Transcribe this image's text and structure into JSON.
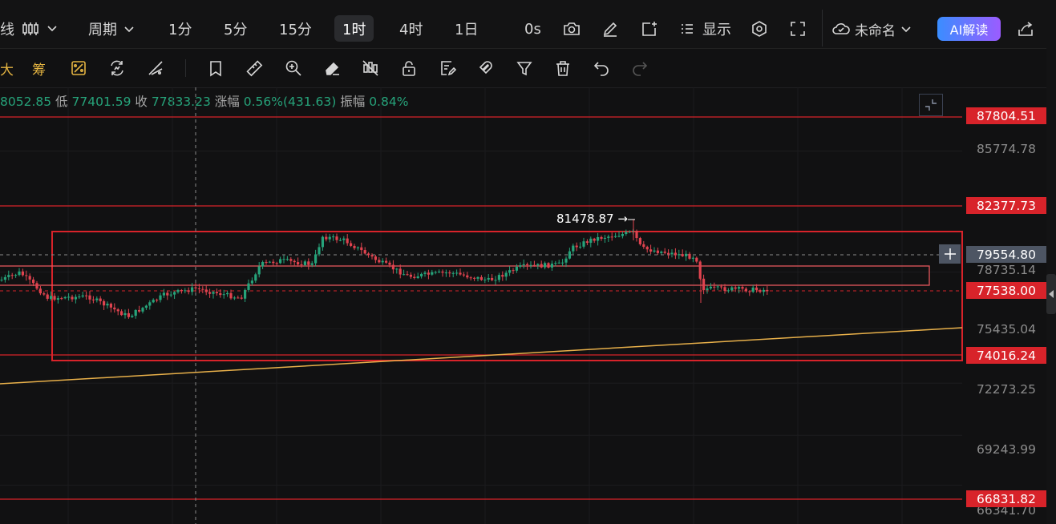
{
  "topbar": {
    "chart_type_partial": "线",
    "period_label": "周期",
    "timeframes": [
      "1分",
      "5分",
      "15分",
      "1时",
      "4时",
      "1日"
    ],
    "active_timeframe": "1时",
    "countdown": "0s",
    "display_label": "显示",
    "layout_name": "未命名",
    "ai_button": "AI解读"
  },
  "toolbar2": {
    "text_items": [
      "大",
      "筹"
    ]
  },
  "info_row": {
    "high_partial": "8052.85",
    "low_label": "低",
    "low_value": "77401.59",
    "close_label": "收",
    "close_value": "77833.23",
    "change_label": "涨幅",
    "change_value": "0.56%(431.63)",
    "amplitude_label": "振幅",
    "amplitude_value": "0.84%"
  },
  "chart_data": {
    "type": "candlestick",
    "interval": "1时",
    "axis_ticks": [
      "85774.78",
      "78735.14",
      "75435.04",
      "72273.25",
      "69243.99",
      "66341.70"
    ],
    "horizontal_levels": [
      "87804.51",
      "82377.73",
      "74016.24",
      "66831.82"
    ],
    "crosshair_price": "79554.80",
    "last_price": "77538.00",
    "annotated_high": "81478.87",
    "colors": {
      "up": "#26a37a",
      "down": "#e0434f",
      "level": "#d8232a",
      "trend": "#e8b04a"
    }
  },
  "price_labels": {
    "p1": "87804.51",
    "p2": "85774.78",
    "p3": "82377.73",
    "p4": "79554.80",
    "p5": "78735.14",
    "p6": "77538.00",
    "p7": "75435.04",
    "p8": "74016.24",
    "p9": "72273.25",
    "p10": "69243.99",
    "p11": "66831.82",
    "p12": "66341.70"
  },
  "annotation": {
    "high_text": "81478.87 →"
  }
}
